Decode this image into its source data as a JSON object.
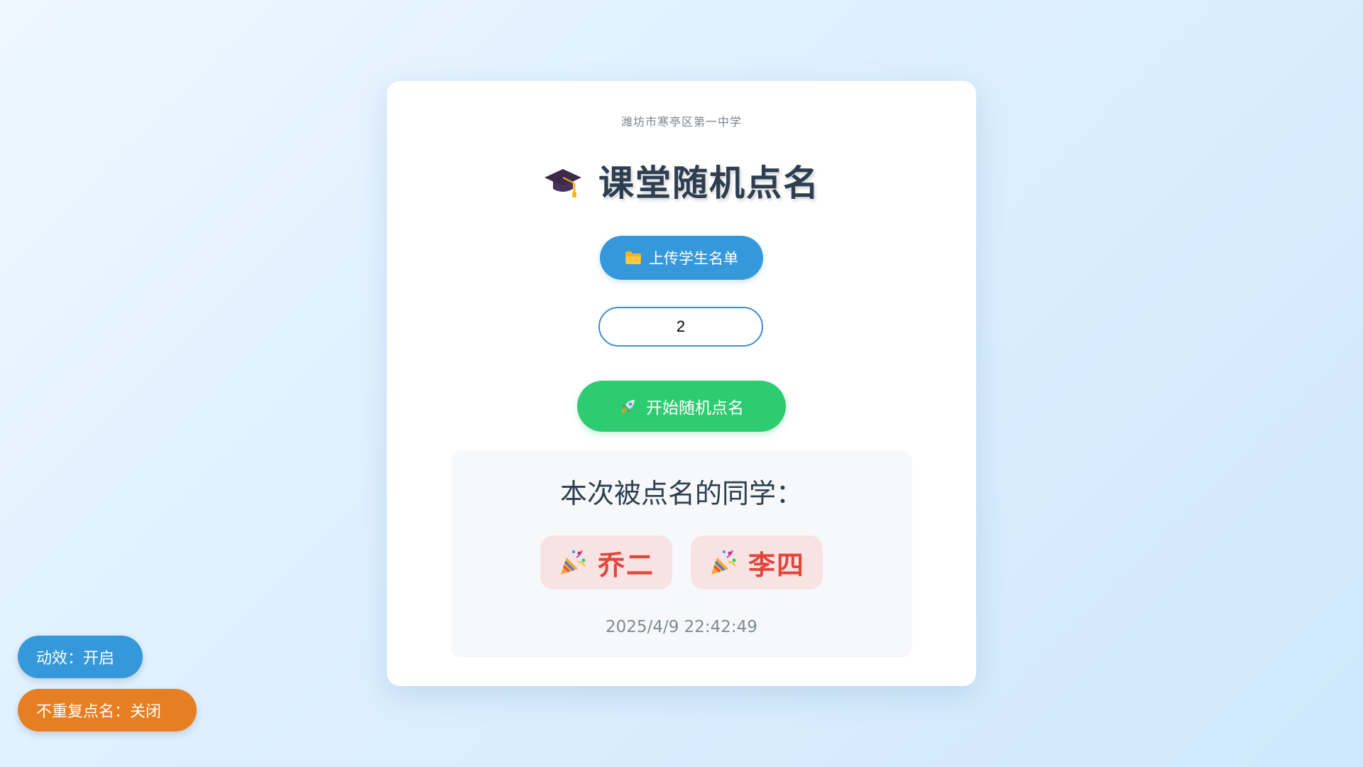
{
  "header": {
    "school": "潍坊市寒亭区第一中学",
    "title": "课堂随机点名",
    "title_icon": "graduation-cap-icon"
  },
  "controls": {
    "upload_label": "上传学生名单",
    "upload_icon": "folder-icon",
    "count_value": "2",
    "start_label": "开始随机点名",
    "start_icon": "rocket-icon"
  },
  "result": {
    "heading": "本次被点名的同学：",
    "names": [
      {
        "name": "乔二",
        "icon": "party-popper-icon"
      },
      {
        "name": "李四",
        "icon": "party-popper-icon"
      }
    ],
    "timestamp": "2025/4/9 22:42:49"
  },
  "toggles": {
    "animation_label": "动效：开启",
    "no_repeat_label": "不重复点名：关闭"
  },
  "colors": {
    "primary_blue": "#3498db",
    "start_green": "#2ecc71",
    "toggle_orange": "#e67e22",
    "name_red": "#e2453c",
    "title_dark": "#2c3e50"
  }
}
